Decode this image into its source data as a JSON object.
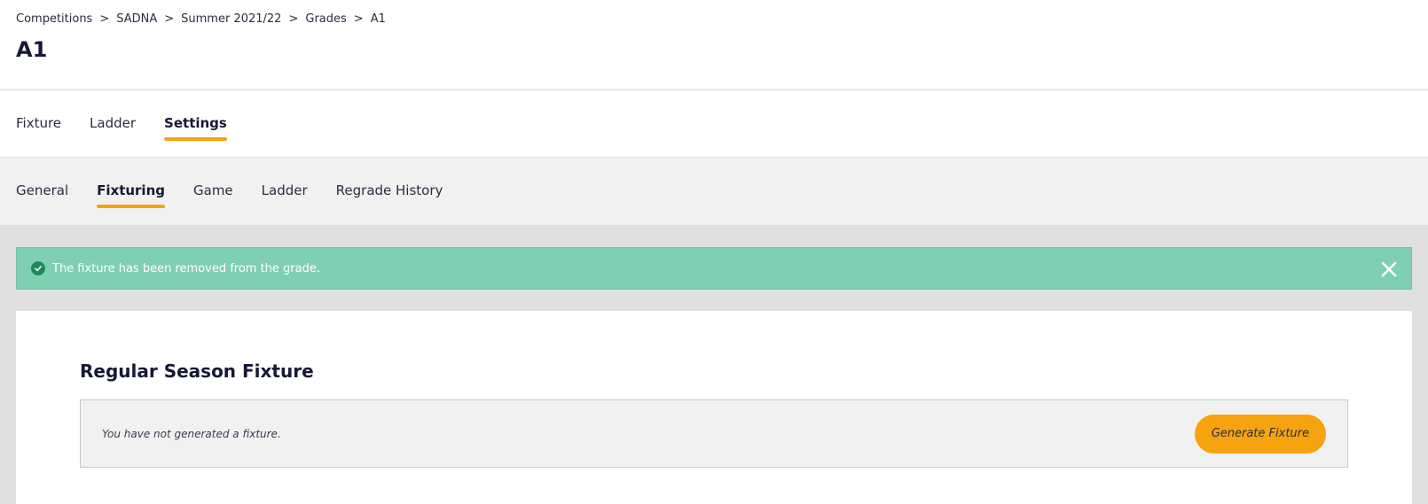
{
  "breadcrumb": {
    "items": [
      "Competitions",
      "SADNA",
      "Summer 2021/22",
      "Grades",
      "A1"
    ],
    "separator": ">"
  },
  "page": {
    "title": "A1"
  },
  "main_tabs": [
    {
      "label": "Fixture",
      "active": false
    },
    {
      "label": "Ladder",
      "active": false
    },
    {
      "label": "Settings",
      "active": true
    }
  ],
  "sub_tabs": [
    {
      "label": "General",
      "active": false
    },
    {
      "label": "Fixturing",
      "active": true
    },
    {
      "label": "Game",
      "active": false
    },
    {
      "label": "Ladder",
      "active": false
    },
    {
      "label": "Regrade History",
      "active": false
    }
  ],
  "alert": {
    "message": "The fixture has been removed from the grade.",
    "icon": "check-circle-icon",
    "close_icon": "close-icon"
  },
  "fixture_section": {
    "title": "Regular Season Fixture",
    "empty_message": "You have not generated a fixture.",
    "generate_label": "Generate Fixture"
  },
  "colors": {
    "accent": "#f5a30f",
    "success": "#7fcfb3",
    "text_dark": "#161836"
  }
}
